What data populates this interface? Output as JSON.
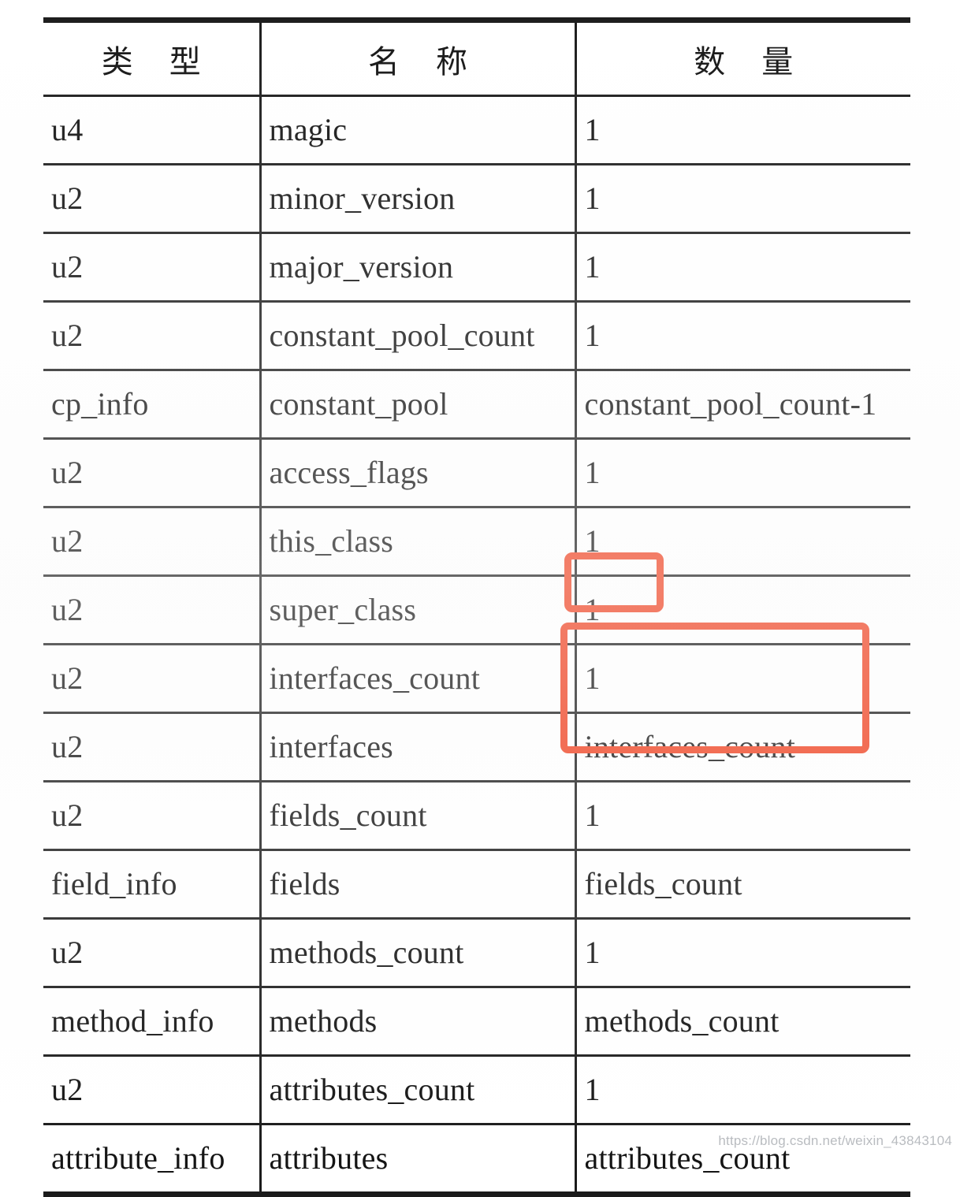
{
  "document": {
    "kind": "scanned-book-table",
    "caption_absent": true
  },
  "table": {
    "headers": {
      "type": "类 型",
      "name": "名 称",
      "quantity": "数 量"
    },
    "rows": [
      {
        "type": "u4",
        "name": "magic",
        "quantity": "1"
      },
      {
        "type": "u2",
        "name": "minor_version",
        "quantity": "1"
      },
      {
        "type": "u2",
        "name": "major_version",
        "quantity": "1"
      },
      {
        "type": "u2",
        "name": "constant_pool_count",
        "quantity": "1"
      },
      {
        "type": "cp_info",
        "name": "constant_pool",
        "quantity": "constant_pool_count-1"
      },
      {
        "type": "u2",
        "name": "access_flags",
        "quantity": "1"
      },
      {
        "type": "u2",
        "name": "this_class",
        "quantity": "1"
      },
      {
        "type": "u2",
        "name": "super_class",
        "quantity": "1"
      },
      {
        "type": "u2",
        "name": "interfaces_count",
        "quantity": "1"
      },
      {
        "type": "u2",
        "name": "interfaces",
        "quantity": "interfaces_count"
      },
      {
        "type": "u2",
        "name": "fields_count",
        "quantity": "1"
      },
      {
        "type": "field_info",
        "name": "fields",
        "quantity": "fields_count"
      },
      {
        "type": "u2",
        "name": "methods_count",
        "quantity": "1"
      },
      {
        "type": "method_info",
        "name": "methods",
        "quantity": "methods_count"
      },
      {
        "type": "u2",
        "name": "attributes_count",
        "quantity": "1"
      },
      {
        "type": "attribute_info",
        "name": "attributes",
        "quantity": "attributes_count"
      }
    ]
  },
  "annotations": {
    "color": "#f0401f",
    "boxes": [
      {
        "id": "anno-super",
        "targets": "super_class quantity cell",
        "label": ""
      },
      {
        "id": "anno-iface",
        "targets": "interfaces_count and interfaces quantity cells",
        "label": ""
      }
    ]
  },
  "watermark": {
    "text": "https://blog.csdn.net/weixin_43843104"
  }
}
